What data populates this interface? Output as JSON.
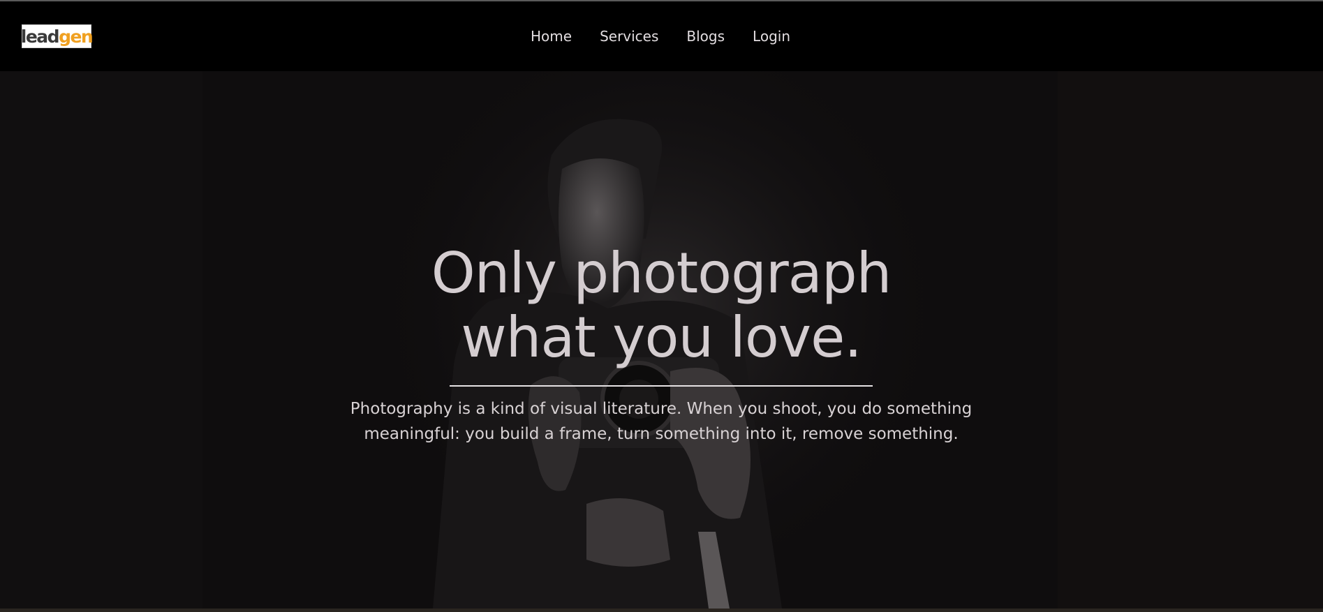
{
  "brand": {
    "logo_lead": "lead",
    "logo_gen": "gen",
    "accent": "#f0a020"
  },
  "nav": {
    "items": [
      {
        "label": "Home"
      },
      {
        "label": "Services"
      },
      {
        "label": "Blogs"
      },
      {
        "label": "Login"
      }
    ]
  },
  "hero": {
    "headline_line1": "Only photograph",
    "headline_line2": "what you love.",
    "subtext": "Photography is a kind of visual literature. When you shoot, you do something meaningful: you build a frame, turn something into it, remove something.",
    "background_image": "photographer-holding-camera"
  },
  "colors": {
    "navbar": "#000000",
    "hero_bg": "#0f0d0e",
    "text": "#d4cdd0"
  }
}
